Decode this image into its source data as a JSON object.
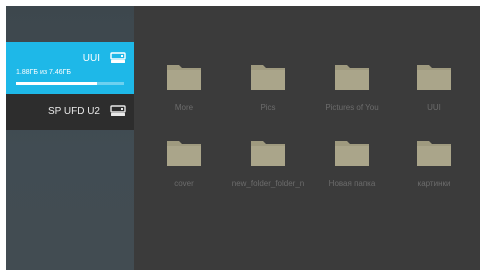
{
  "drives": [
    {
      "name": "UUI",
      "size_text": "1.88ГБ из 7.46ГБ",
      "usage_fraction": 0.75,
      "selected": true,
      "icon": "drive-icon"
    },
    {
      "name": "SP UFD U2",
      "selected": false,
      "icon": "drive-icon"
    }
  ],
  "folders": [
    {
      "label": "More",
      "icon": "folder-icon"
    },
    {
      "label": "Pics",
      "icon": "folder-icon"
    },
    {
      "label": "Pictures of You",
      "icon": "folder-icon"
    },
    {
      "label": "UUI",
      "icon": "folder-icon"
    },
    {
      "label": "cover",
      "icon": "folder-icon"
    },
    {
      "label": "new_folder_folder_n",
      "icon": "folder-icon"
    },
    {
      "label": "Новая папка",
      "icon": "folder-icon"
    },
    {
      "label": "картинки",
      "icon": "folder-icon"
    }
  ],
  "colors": {
    "accent": "#1eb8e8",
    "folder": "#aaa58a",
    "folder_tab": "#9f9a7f",
    "label": "#6c6c6c"
  }
}
